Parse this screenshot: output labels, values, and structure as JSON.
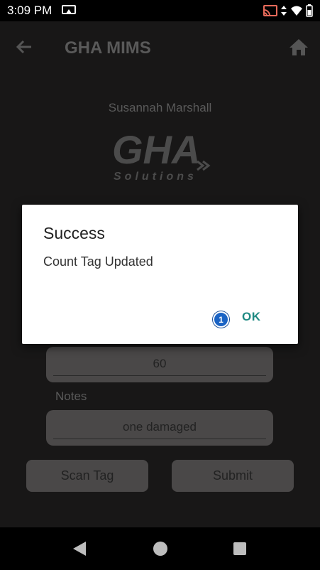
{
  "status_bar": {
    "time": "3:09 PM",
    "icons": [
      "cast-icon",
      "data-arrows-icon",
      "wifi-icon",
      "battery-icon"
    ]
  },
  "toolbar": {
    "title": "GHA MIMS",
    "back_icon": "arrow-left-icon",
    "home_icon": "home-icon"
  },
  "user": {
    "name": "Susannah Marshall"
  },
  "logo": {
    "main": "GHA",
    "sub": "Solutions"
  },
  "form": {
    "quantity_value": "60",
    "notes_label": "Notes",
    "notes_value": "one damaged"
  },
  "buttons": {
    "scan_tag": "Scan Tag",
    "submit": "Submit"
  },
  "dialog": {
    "title": "Success",
    "message": "Count Tag Updated",
    "ok_label": "OK",
    "badge_number": "1"
  },
  "colors": {
    "app_background": "#181717",
    "dialog_ok": "#1f8a83",
    "badge": "#1a63c4"
  }
}
